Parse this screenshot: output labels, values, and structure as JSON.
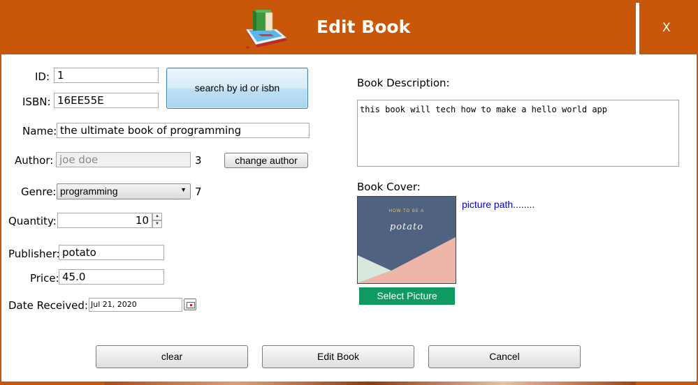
{
  "window": {
    "title": "Edit Book",
    "close_label": "X",
    "accent_color": "#c9570a"
  },
  "form": {
    "id": {
      "label": "ID:",
      "value": "1"
    },
    "isbn": {
      "label": "ISBN:",
      "value": "16EE55E"
    },
    "search_button": "search by id or isbn",
    "name": {
      "label": "Name:",
      "value": "the ultimate book of programming"
    },
    "author": {
      "label": "Author:",
      "value": "joe doe",
      "id_value": "3",
      "change_button": "change author"
    },
    "genre": {
      "label": "Genre:",
      "value": "programming",
      "id_value": "7"
    },
    "quantity": {
      "label": "Quantity:",
      "value": "10"
    },
    "publisher": {
      "label": "Publisher:",
      "value": "potato"
    },
    "price": {
      "label": "Price:",
      "value": "45.0"
    },
    "date_received": {
      "label": "Date Received:",
      "value": "Jul 21, 2020"
    }
  },
  "description": {
    "label": "Book Description:",
    "value": "this book will tech how to make a hello world app"
  },
  "cover": {
    "label": "Book Cover:",
    "image_top_text": "HOW TO BE A",
    "image_title": "potato",
    "picture_path": "picture path........",
    "select_button": "Select Picture",
    "select_color": "#0e9a60"
  },
  "actions": {
    "clear": "clear",
    "edit": "Edit Book",
    "cancel": "Cancel"
  }
}
